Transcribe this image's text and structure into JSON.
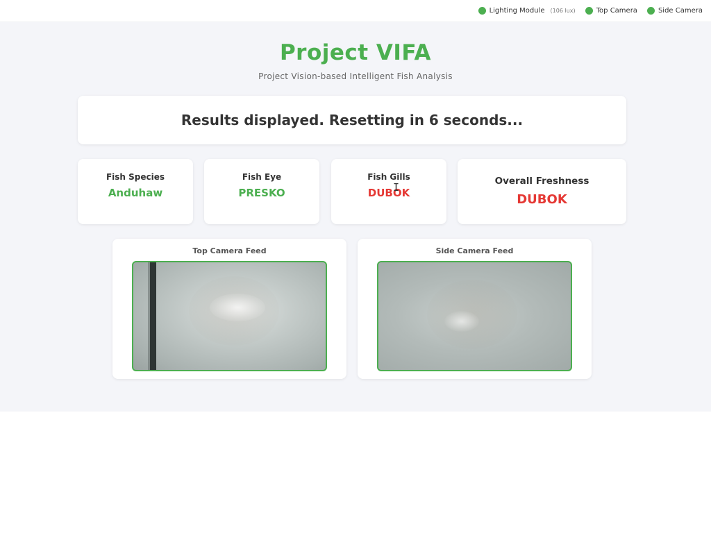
{
  "status_bar": {
    "items": [
      {
        "label": "Lighting Module",
        "extra": "(106 lux)",
        "color": "#4caf50"
      },
      {
        "label": "Top Camera",
        "color": "#4caf50"
      },
      {
        "label": "Side Camera",
        "color": "#4caf50"
      }
    ]
  },
  "header": {
    "title": "Project VIFA",
    "subtitle": "Project Vision-based Intelligent Fish Analysis"
  },
  "result_banner": "Results displayed. Resetting in 6 seconds...",
  "metrics": [
    {
      "label": "Fish Species",
      "value": "Anduhaw",
      "status": "good"
    },
    {
      "label": "Fish Eye",
      "value": "PRESKO",
      "status": "good"
    },
    {
      "label": "Fish Gills",
      "value": "DUBOK",
      "status": "bad"
    },
    {
      "label": "Overall Freshness",
      "value": "DUBOK",
      "status": "bad"
    }
  ],
  "cameras": [
    {
      "label": "Top Camera Feed"
    },
    {
      "label": "Side Camera Feed"
    }
  ],
  "colors": {
    "accent": "#4caf50",
    "good": "#4caf50",
    "bad": "#e53935",
    "background": "#f4f5f9"
  },
  "icons": [
    "status-dot-icon",
    "text-cursor-icon"
  ]
}
